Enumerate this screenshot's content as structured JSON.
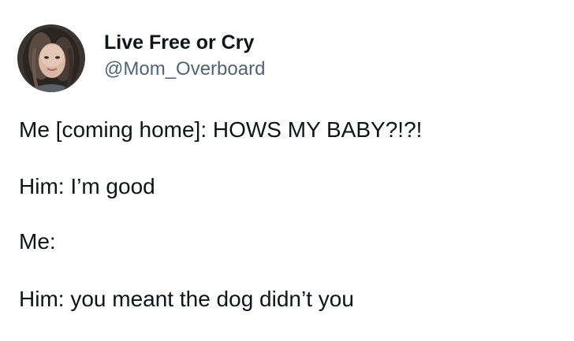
{
  "tweet": {
    "author": {
      "display_name": "Live Free or Cry",
      "handle": "@Mom_Overboard",
      "avatar_icon": "profile-photo-avatar"
    },
    "lines": [
      "Me [coming home]: HOWS MY BABY?!?!",
      "Him: I’m good",
      "Me:",
      "Him: you meant the dog didn’t you"
    ]
  },
  "colors": {
    "text": "#0f1419",
    "secondary_text": "#536471",
    "background": "#ffffff"
  }
}
